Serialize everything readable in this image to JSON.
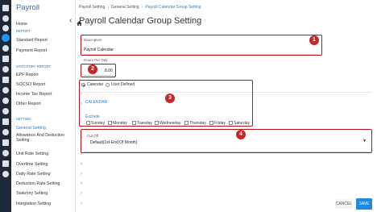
{
  "app": {
    "title": "Payroll"
  },
  "sidebar": {
    "home": "Home",
    "report_section": "REPORT",
    "report_items": [
      "Standard Report",
      "Payment Report"
    ],
    "statutory_section": "STATUTORY REPORT",
    "statutory_items": [
      "EPF Report",
      "SOCSO Report",
      "Income Tax Report",
      "Other Report"
    ],
    "setting_section": "SETTING",
    "setting_items": [
      "General Setting",
      "Allowance And Deduction Setting",
      "Unit Rate Setting",
      "Overtime Setting",
      "Daily Rate Setting",
      "Deduction Rate Setting",
      "Statutory Setting",
      "Integration Setting"
    ],
    "active_item": "General Setting"
  },
  "breadcrumb": {
    "items": [
      "Payroll Setting",
      "General Setting",
      "Payroll Calendar Group Setting"
    ]
  },
  "page": {
    "title": "Payroll Calendar Group Setting"
  },
  "form": {
    "description": {
      "label": "Description",
      "value": "Payroll Calendar"
    },
    "hours_per_day": {
      "label": "Hours Per Day",
      "value": "8.00"
    },
    "mode": {
      "options": [
        "Calendar",
        "User Defined"
      ],
      "selected": "Calendar"
    },
    "calendar_heading": "CALENDAR",
    "exclude": {
      "label": "Exclude",
      "days": [
        "Sunday",
        "Monday",
        "Tuesday",
        "Wednesday",
        "Thursday",
        "Friday",
        "Saturday"
      ]
    },
    "cut_off": {
      "label": "Cut Off",
      "value": "Default(1st-End Of Month)"
    }
  },
  "annotations": {
    "badges": [
      "1",
      "2",
      "3",
      "4"
    ],
    "color": "#b5121b"
  },
  "actions": {
    "cancel": "CANCEL",
    "save": "SAVE"
  },
  "colors": {
    "rail": "#1d2838",
    "accent": "#2a7fd4",
    "save": "#1e88e5"
  },
  "icons": [
    "dashboard-icon",
    "employee-icon",
    "payroll-icon",
    "leave-icon",
    "claim-icon",
    "attendance-icon",
    "report-icon",
    "settings-icon",
    "home-icon",
    "back-arrow-icon",
    "dropdown-caret-icon"
  ]
}
